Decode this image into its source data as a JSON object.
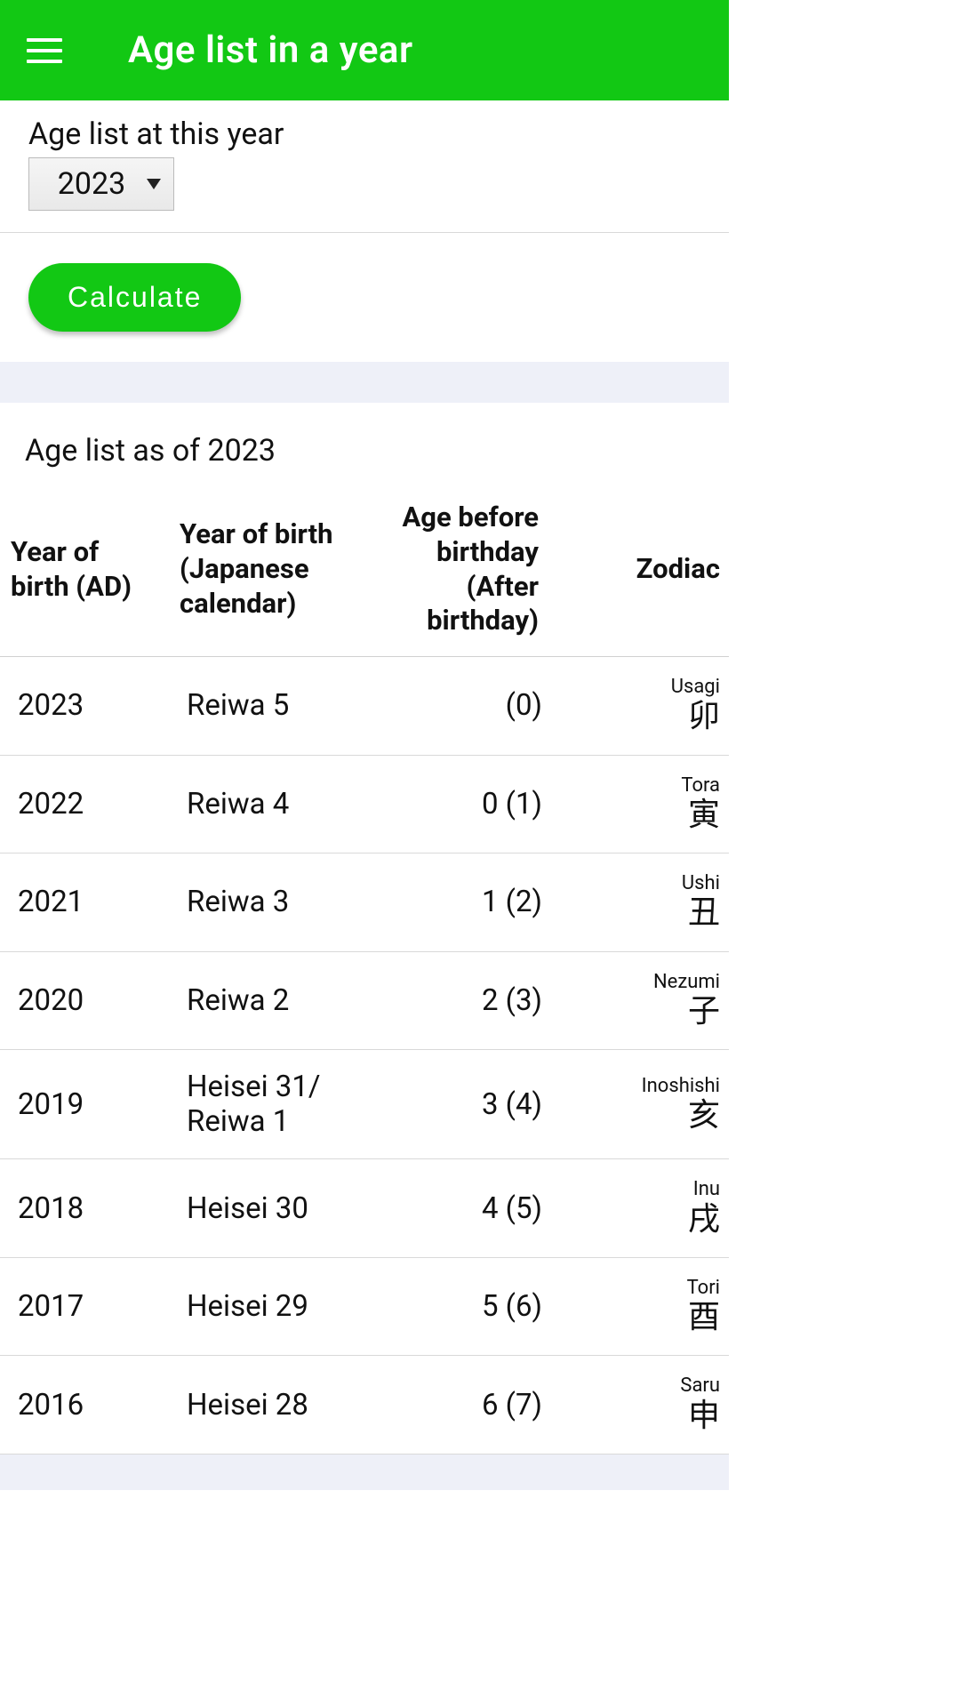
{
  "header": {
    "title": "Age list in a year"
  },
  "year_section": {
    "label": "Age list at this year",
    "selected_year": "2023"
  },
  "calculate_label": "Calculate",
  "result_title": "Age list as of 2023",
  "columns": {
    "ad": "Year of birth (AD)",
    "jp": "Year of birth (Japanese calendar)",
    "age": "Age before birthday (After birthday)",
    "zodiac": "Zodiac"
  },
  "rows": [
    {
      "ad": "2023",
      "jp": "Reiwa 5",
      "age": "(0)",
      "zodiac_en": "Usagi",
      "zodiac_jp": "卯"
    },
    {
      "ad": "2022",
      "jp": "Reiwa 4",
      "age": "0 (1)",
      "zodiac_en": "Tora",
      "zodiac_jp": "寅"
    },
    {
      "ad": "2021",
      "jp": "Reiwa 3",
      "age": "1 (2)",
      "zodiac_en": "Ushi",
      "zodiac_jp": "丑"
    },
    {
      "ad": "2020",
      "jp": "Reiwa 2",
      "age": "2 (3)",
      "zodiac_en": "Nezumi",
      "zodiac_jp": "子"
    },
    {
      "ad": "2019",
      "jp": "Heisei 31/ Reiwa 1",
      "age": "3 (4)",
      "zodiac_en": "Inoshishi",
      "zodiac_jp": "亥"
    },
    {
      "ad": "2018",
      "jp": "Heisei 30",
      "age": "4 (5)",
      "zodiac_en": "Inu",
      "zodiac_jp": "戌"
    },
    {
      "ad": "2017",
      "jp": "Heisei 29",
      "age": "5 (6)",
      "zodiac_en": "Tori",
      "zodiac_jp": "酉"
    },
    {
      "ad": "2016",
      "jp": "Heisei 28",
      "age": "6 (7)",
      "zodiac_en": "Saru",
      "zodiac_jp": "申"
    }
  ]
}
